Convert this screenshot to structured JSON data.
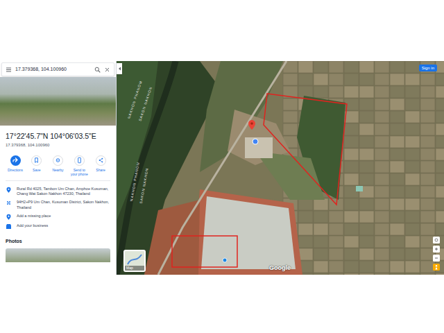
{
  "search": {
    "value": "17.379368, 104.100960"
  },
  "place": {
    "title": "17°22'45.7\"N 104°06'03.5\"E",
    "subtitle": "17.379368, 104.100960"
  },
  "actions": [
    {
      "label": "Directions",
      "kind": "primary"
    },
    {
      "label": "Save",
      "kind": "secondary"
    },
    {
      "label": "Nearby",
      "kind": "secondary"
    },
    {
      "label": "Send to your phone",
      "kind": "secondary"
    },
    {
      "label": "Share",
      "kind": "secondary"
    }
  ],
  "details": [
    {
      "kind": "address",
      "text": "Rural Rd 4025, Tambon Um Chan, Amphoe Kusuman, Chang Wat Sakon Nakhon 47230, Thailand"
    },
    {
      "kind": "pluscode",
      "text": "94H2+P9 Um Chan, Kusuman District, Sakon Nakhon, Thailand"
    },
    {
      "kind": "addplace",
      "text": "Add a missing place"
    },
    {
      "kind": "business",
      "text": "Add your business"
    }
  ],
  "photos_heading": "Photos",
  "map": {
    "sign_in": "Sign in",
    "logo": "Google",
    "layer_toggle": "Map",
    "province_labels": [
      "NAKHON PHANOM",
      "SAKON NAKHON",
      "NAKHON PHANOM",
      "SAKON NAKHON"
    ]
  }
}
